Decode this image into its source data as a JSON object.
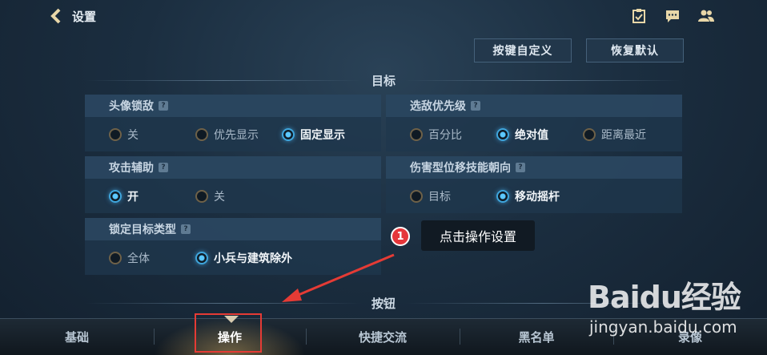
{
  "header": {
    "back_label": "设置",
    "icons": [
      "task-icon",
      "chat-icon",
      "friends-icon"
    ]
  },
  "actions": {
    "custom_keys": "按键自定义",
    "restore_default": "恢复默认"
  },
  "sections": {
    "target": "目标",
    "buttons": "按钮"
  },
  "cards": {
    "avatar_lock": {
      "title": "头像锁敌",
      "options": [
        "关",
        "优先显示",
        "固定显示"
      ],
      "selected": "固定显示"
    },
    "target_priority": {
      "title": "选敌优先级",
      "options": [
        "百分比",
        "绝对值",
        "距离最近"
      ],
      "selected": "绝对值"
    },
    "attack_assist": {
      "title": "攻击辅助",
      "options": [
        "开",
        "关"
      ],
      "selected": "开"
    },
    "skill_direction": {
      "title": "伤害型位移技能朝向",
      "options": [
        "目标",
        "移动摇杆"
      ],
      "selected": "移动摇杆"
    },
    "lock_target_type": {
      "title": "锁定目标类型",
      "options": [
        "全体",
        "小兵与建筑除外"
      ],
      "selected": "小兵与建筑除外"
    }
  },
  "annotation": {
    "badge": "1",
    "text": "点击操作设置"
  },
  "tabs": [
    {
      "label": "基础",
      "active": false
    },
    {
      "label": "操作",
      "active": true
    },
    {
      "label": "快捷交流",
      "active": false
    },
    {
      "label": "黑名单",
      "active": false
    },
    {
      "label": "录像",
      "active": false
    }
  ],
  "watermark": {
    "logo": "Baidu经验",
    "url": "jingyan.baidu.com"
  },
  "colors": {
    "radio_selected": "#3fa6dd",
    "annotation_red": "#e5363a",
    "highlight_box": "#e53b35"
  }
}
